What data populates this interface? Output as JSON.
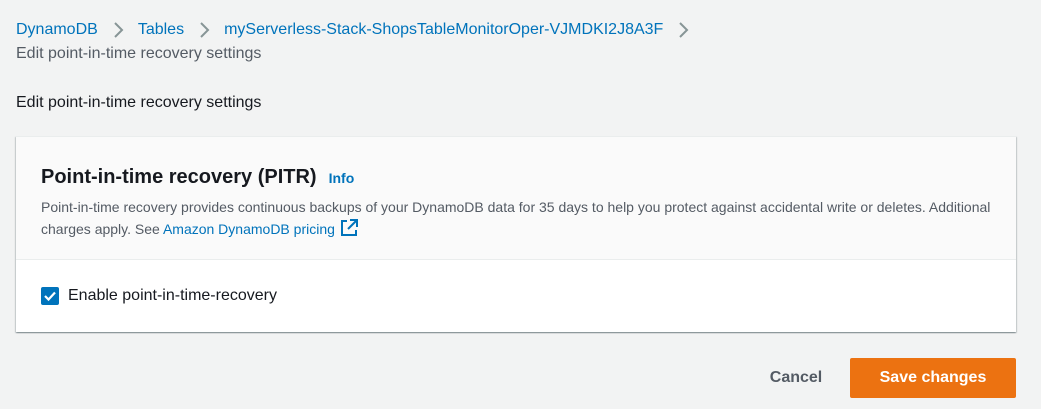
{
  "breadcrumb": {
    "items": [
      {
        "label": "DynamoDB"
      },
      {
        "label": "Tables"
      },
      {
        "label": "myServerless-Stack-ShopsTableMonitorOper-VJMDKI2J8A3F"
      }
    ],
    "current": "Edit point-in-time recovery settings"
  },
  "page": {
    "heading": "Edit point-in-time recovery settings"
  },
  "pitr": {
    "title": "Point-in-time recovery (PITR)",
    "info_label": "Info",
    "description": "Point-in-time recovery provides continuous backups of your DynamoDB data for 35 days to help you protect against accidental write or deletes. Additional charges apply. See ",
    "pricing_link": "Amazon DynamoDB pricing",
    "external_icon": "external-link-icon",
    "checkbox_label": "Enable point-in-time-recovery",
    "checkbox_checked": true
  },
  "footer": {
    "cancel_label": "Cancel",
    "save_label": "Save changes"
  },
  "colors": {
    "link": "#0073bb",
    "primary_button": "#ec7211",
    "background": "#f2f3f3"
  }
}
